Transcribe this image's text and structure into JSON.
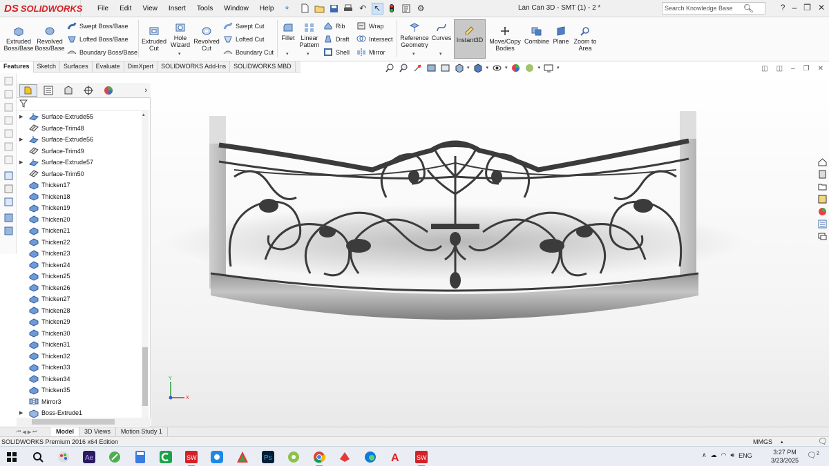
{
  "app": {
    "brand": "SOLIDWORKS",
    "brand_mark": "DS",
    "document_title": "Lan Can 3D - SMT (1) - 2 *"
  },
  "menu": [
    "File",
    "Edit",
    "View",
    "Insert",
    "Tools",
    "Window",
    "Help"
  ],
  "search": {
    "placeholder": "Search Knowledge Base"
  },
  "ribbon": {
    "extruded_boss": "Extruded Boss/Base",
    "revolved_boss": "Revolved Boss/Base",
    "swept_boss": "Swept Boss/Base",
    "lofted_boss": "Lofted Boss/Base",
    "boundary_boss": "Boundary Boss/Base",
    "extruded_cut": "Extruded Cut",
    "hole_wizard": "Hole Wizard",
    "revolved_cut": "Revolved Cut",
    "swept_cut": "Swept Cut",
    "lofted_cut": "Lofted Cut",
    "boundary_cut": "Boundary Cut",
    "fillet": "Fillet",
    "linear_pattern": "Linear Pattern",
    "rib": "Rib",
    "draft": "Draft",
    "shell": "Shell",
    "wrap": "Wrap",
    "intersect": "Intersect",
    "mirror": "Mirror",
    "reference_geometry": "Reference Geometry",
    "curves": "Curves",
    "instant3d": "Instant3D",
    "move_copy": "Move/Copy Bodies",
    "combine": "Combine",
    "plane": "Plane",
    "zoom_to_area": "Zoom to Area"
  },
  "command_tabs": [
    "Features",
    "Sketch",
    "Surfaces",
    "Evaluate",
    "DimXpert",
    "SOLIDWORKS Add-Ins",
    "SOLIDWORKS MBD"
  ],
  "tree": [
    {
      "label": "Surface-Extrude55",
      "expandable": true,
      "icon": "surface-extrude-icon"
    },
    {
      "label": "Surface-Trim48",
      "expandable": false,
      "icon": "surface-trim-icon"
    },
    {
      "label": "Surface-Extrude56",
      "expandable": true,
      "icon": "surface-extrude-icon"
    },
    {
      "label": "Surface-Trim49",
      "expandable": false,
      "icon": "surface-trim-icon"
    },
    {
      "label": "Surface-Extrude57",
      "expandable": true,
      "icon": "surface-extrude-icon"
    },
    {
      "label": "Surface-Trim50",
      "expandable": false,
      "icon": "surface-trim-icon"
    },
    {
      "label": "Thicken17",
      "expandable": false,
      "icon": "thicken-icon"
    },
    {
      "label": "Thicken18",
      "expandable": false,
      "icon": "thicken-icon"
    },
    {
      "label": "Thicken19",
      "expandable": false,
      "icon": "thicken-icon"
    },
    {
      "label": "Thicken20",
      "expandable": false,
      "icon": "thicken-icon"
    },
    {
      "label": "Thicken21",
      "expandable": false,
      "icon": "thicken-icon"
    },
    {
      "label": "Thicken22",
      "expandable": false,
      "icon": "thicken-icon"
    },
    {
      "label": "Thicken23",
      "expandable": false,
      "icon": "thicken-icon"
    },
    {
      "label": "Thicken24",
      "expandable": false,
      "icon": "thicken-icon"
    },
    {
      "label": "Thicken25",
      "expandable": false,
      "icon": "thicken-icon"
    },
    {
      "label": "Thicken26",
      "expandable": false,
      "icon": "thicken-icon"
    },
    {
      "label": "Thicken27",
      "expandable": false,
      "icon": "thicken-icon"
    },
    {
      "label": "Thicken28",
      "expandable": false,
      "icon": "thicken-icon"
    },
    {
      "label": "Thicken29",
      "expandable": false,
      "icon": "thicken-icon"
    },
    {
      "label": "Thicken30",
      "expandable": false,
      "icon": "thicken-icon"
    },
    {
      "label": "Thicken31",
      "expandable": false,
      "icon": "thicken-icon"
    },
    {
      "label": "Thicken32",
      "expandable": false,
      "icon": "thicken-icon"
    },
    {
      "label": "Thicken33",
      "expandable": false,
      "icon": "thicken-icon"
    },
    {
      "label": "Thicken34",
      "expandable": false,
      "icon": "thicken-icon"
    },
    {
      "label": "Thicken35",
      "expandable": false,
      "icon": "thicken-icon"
    },
    {
      "label": "Mirror3",
      "expandable": false,
      "icon": "mirror-icon"
    },
    {
      "label": "Boss-Extrude1",
      "expandable": true,
      "icon": "boss-extrude-icon"
    }
  ],
  "model_tabs": [
    "Model",
    "3D Views",
    "Motion Study 1"
  ],
  "status": {
    "edition": "SOLIDWORKS Premium 2016 x64 Edition",
    "units": "MMGS"
  },
  "taskbar": {
    "language": "ENG",
    "time": "3:27 PM",
    "date": "3/23/2025",
    "notification_count": "2"
  },
  "colors": {
    "brand_red": "#d42127",
    "model_iron": "#3b3b3b",
    "accent_blue": "#3a6db5"
  }
}
